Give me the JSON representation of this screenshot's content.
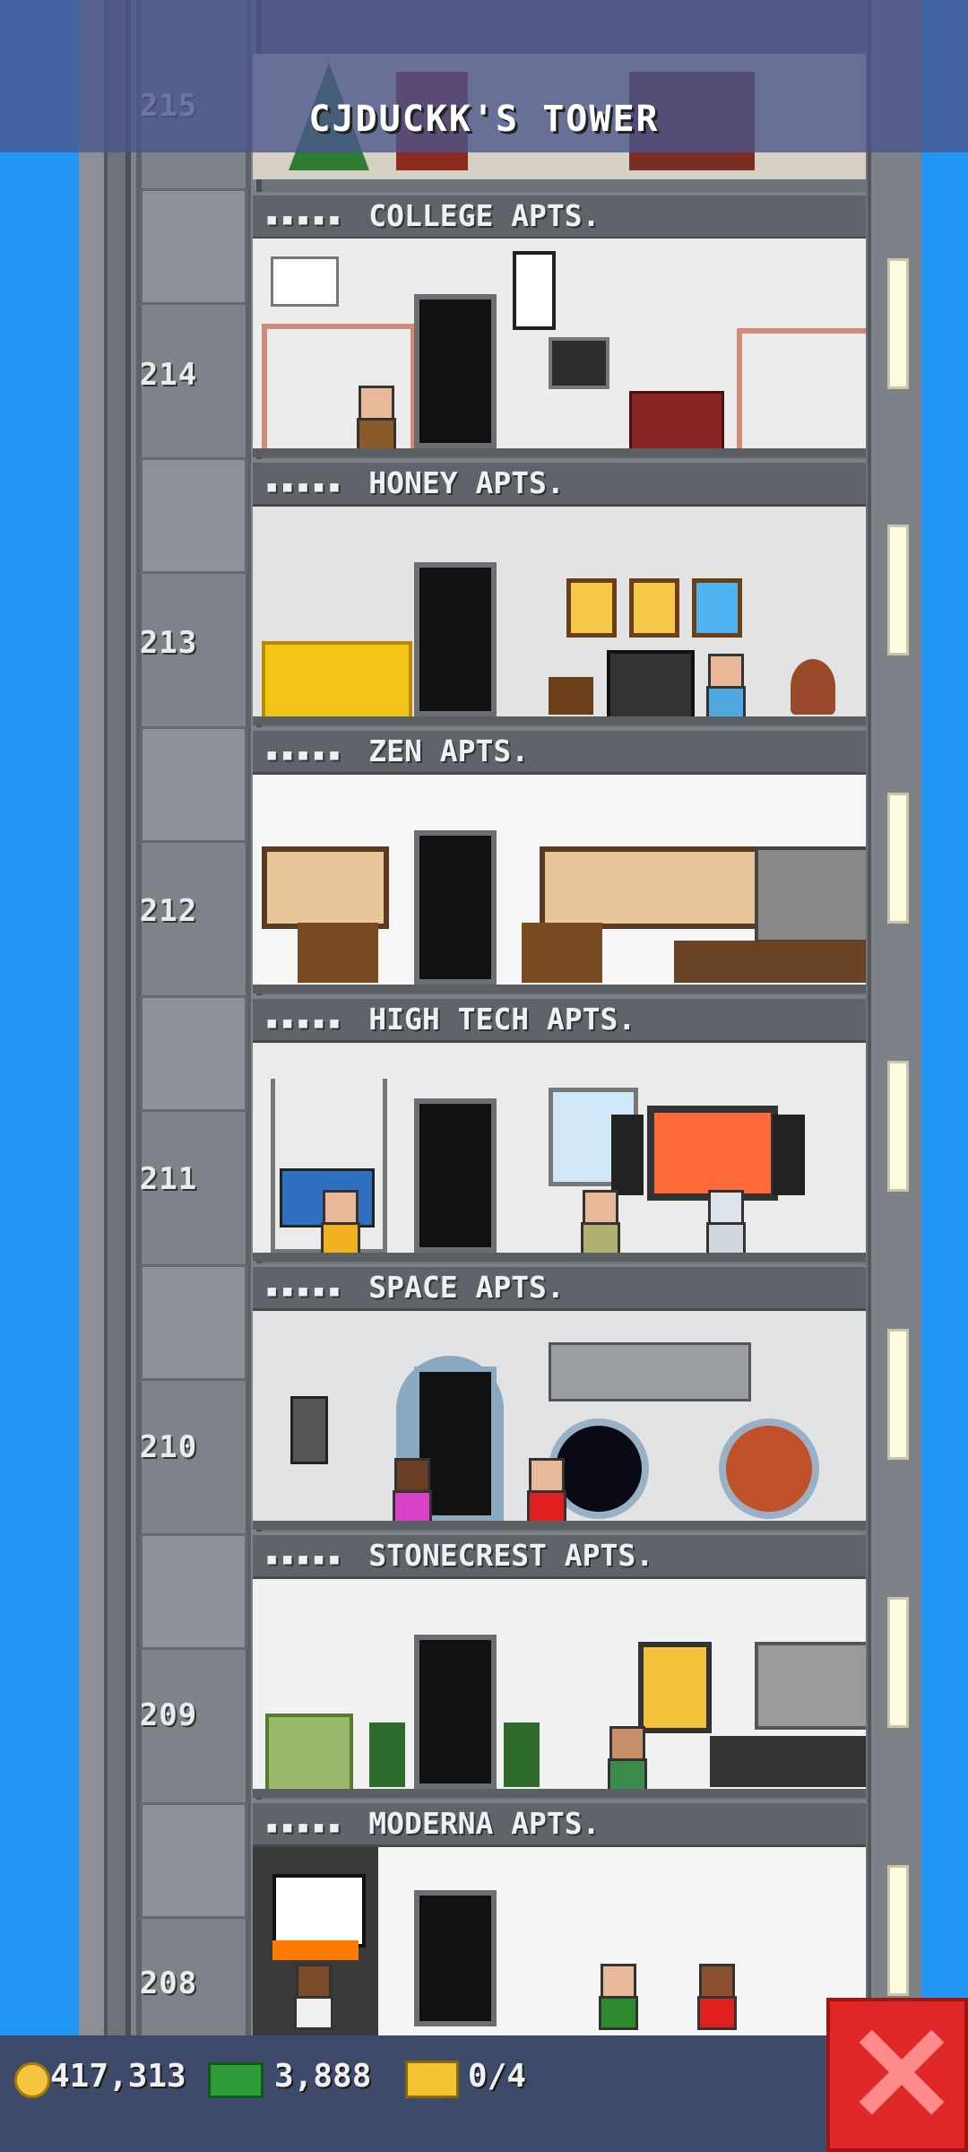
{
  "header": {
    "title": "CJDUCKK'S TOWER",
    "top_floor_number": "215"
  },
  "floors": [
    {
      "number": "214",
      "name": "COLLEGE APTS.",
      "bg": "#ececec",
      "wall": "#f4f4f4"
    },
    {
      "number": "213",
      "name": "HONEY APTS.",
      "bg": "#dedede",
      "wall": "#e9e9e9"
    },
    {
      "number": "212",
      "name": "ZEN APTS.",
      "bg": "#f6f6f6",
      "wall": "#ffffff"
    },
    {
      "number": "211",
      "name": "HIGH TECH APTS.",
      "bg": "#e8e8e8",
      "wall": "#f0f0f0"
    },
    {
      "number": "210",
      "name": "SPACE APTS.",
      "bg": "#d9dadb",
      "wall": "#e7e7e7"
    },
    {
      "number": "209",
      "name": "STONECREST APTS.",
      "bg": "#f1f1f1",
      "wall": "#f9f9f9"
    },
    {
      "number": "208",
      "name": "MODERNA APTS.",
      "bg": "#f3f3f3",
      "wall": "#fafafa"
    }
  ],
  "banner_icons": "▪▪▪▪▪",
  "stats": {
    "coins": "417,313",
    "bux": "3,888",
    "tickets": "0/4"
  },
  "icons": {
    "coin": "coin-icon",
    "bux": "tower-bux-icon",
    "ticket": "golden-ticket-icon",
    "close": "close-icon"
  },
  "colors": {
    "sky": "#2196f3",
    "close_button": "#e02828",
    "header": "#4a548c"
  }
}
